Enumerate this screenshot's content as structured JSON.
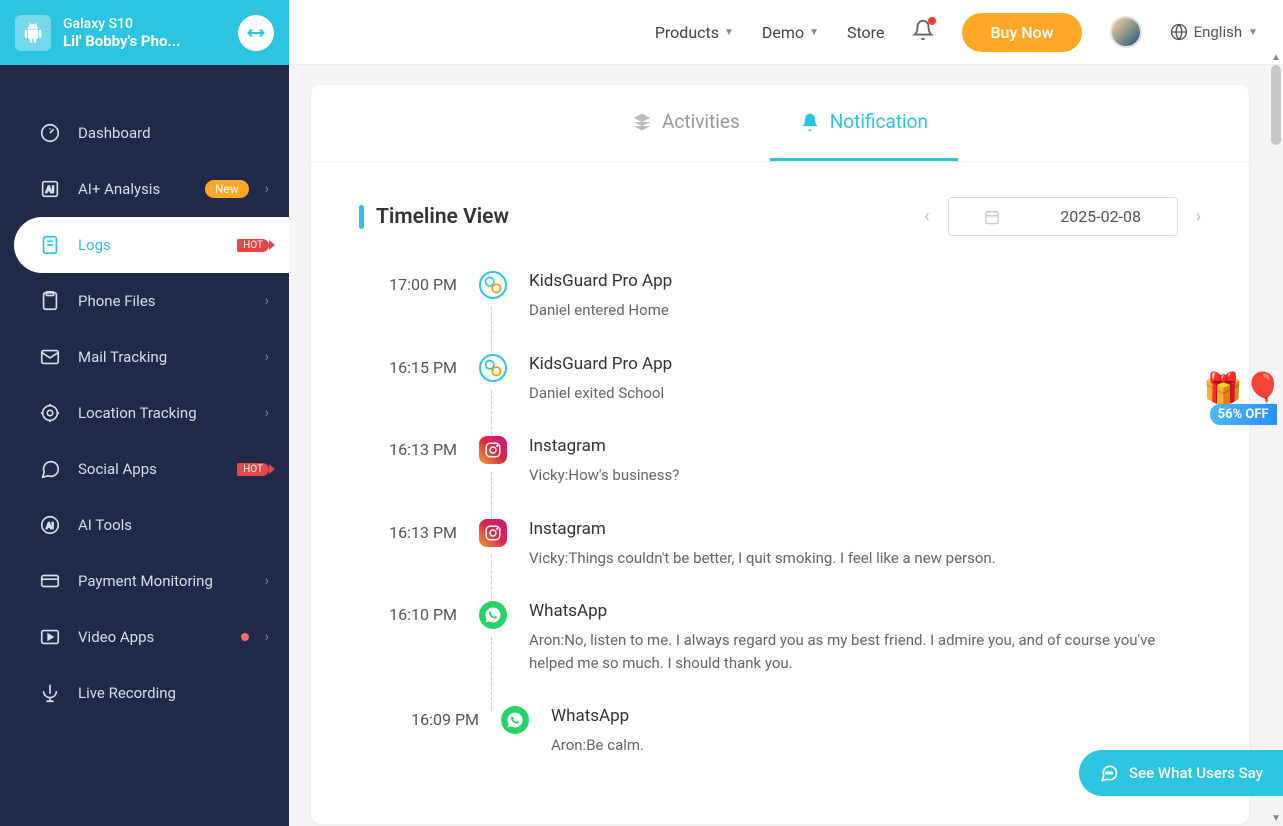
{
  "device": {
    "model": "Galaxy S10",
    "name": "Lil' Bobby's Pho..."
  },
  "topnav": {
    "products": "Products",
    "demo": "Demo",
    "store": "Store",
    "buy": "Buy Now",
    "lang": "English"
  },
  "sidebar": {
    "dashboard": "Dashboard",
    "ai_analysis": "AI+ Analysis",
    "ai_badge": "New",
    "logs": "Logs",
    "logs_hot": "HOT",
    "phone_files": "Phone Files",
    "mail_tracking": "Mail Tracking",
    "location_tracking": "Location Tracking",
    "social_apps": "Social Apps",
    "social_hot": "HOT",
    "ai_tools": "AI Tools",
    "payment_monitoring": "Payment Monitoring",
    "video_apps": "Video Apps",
    "live_recording": "Live Recording"
  },
  "tabs": {
    "activities": "Activities",
    "notification": "Notification"
  },
  "section": {
    "title": "Timeline View",
    "date": "2025-02-08"
  },
  "timeline": [
    {
      "time": "17:00 PM",
      "icon": "kidsguard",
      "app": "KidsGuard Pro App",
      "msg": "Daniel entered Home"
    },
    {
      "time": "16:15 PM",
      "icon": "kidsguard",
      "app": "KidsGuard Pro App",
      "msg": "Daniel exited School"
    },
    {
      "time": "16:13 PM",
      "icon": "instagram",
      "app": "Instagram",
      "msg": "Vicky:How's business?"
    },
    {
      "time": "16:13 PM",
      "icon": "instagram",
      "app": "Instagram",
      "msg": "Vicky:Things couldn't be better, I quit smoking. I feel like a new person."
    },
    {
      "time": "16:10 PM",
      "icon": "whatsapp",
      "app": "WhatsApp",
      "msg": "Aron:No, listen to me. I always regard you as my best friend. I admire you, and of course you've helped me so much. I should thank you."
    },
    {
      "time": "16:09 PM",
      "icon": "whatsapp",
      "app": "WhatsApp",
      "msg": "Aron:Be calm."
    }
  ],
  "float": {
    "users": "See What Users Say",
    "promo": "56% OFF"
  }
}
